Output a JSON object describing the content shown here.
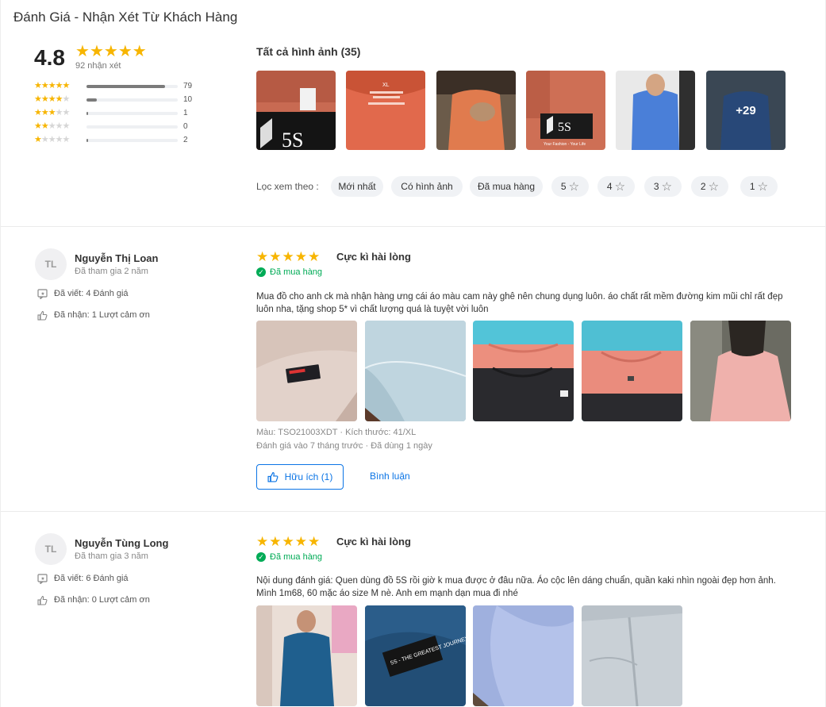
{
  "page_title": "Đánh Giá - Nhận Xét Từ Khách Hàng",
  "summary": {
    "score": "4.8",
    "reviews_count": "92 nhận xét",
    "distribution": [
      {
        "stars": 5,
        "count": "79",
        "fraction": 0.86
      },
      {
        "stars": 4,
        "count": "10",
        "fraction": 0.11
      },
      {
        "stars": 3,
        "count": "1",
        "fraction": 0.01
      },
      {
        "stars": 2,
        "count": "0",
        "fraction": 0.0
      },
      {
        "stars": 1,
        "count": "2",
        "fraction": 0.02
      }
    ]
  },
  "gallery": {
    "title": "Tất cả hình ảnh (35)",
    "more_label": "+29"
  },
  "filters": {
    "label": "Lọc xem theo :",
    "chips": [
      "Mới nhất",
      "Có hình ảnh",
      "Đã mua hàng",
      "5",
      "4",
      "3",
      "2",
      "1"
    ]
  },
  "reviews": [
    {
      "initials": "TL",
      "name": "Nguyễn Thị Loan",
      "joined": "Đã tham gia 2 năm",
      "written": "Đã viết: 4 Đánh giá",
      "received": "Đã nhận: 1 Lượt cảm ơn",
      "title": "Cực kì hài lòng",
      "bought": "Đã mua hàng",
      "text": "Mua đồ cho anh ck mà nhận hàng ưng cái áo màu cam này ghê nên chung dụng luôn. áo chất rất mềm đường kim mũi chỉ rất đẹp luôn nha, tặng shop 5* vì chất lượng quá là tuyệt vời luôn",
      "meta1": "Màu: TSO21003XDT  ·  Kích thước: 41/XL",
      "meta2": "Đánh giá vào 7 tháng trước  ·  Đã dùng 1 ngày",
      "helpful": "Hữu ích (1)",
      "reply": "Bình luận"
    },
    {
      "initials": "TL",
      "name": "Nguyễn Tùng Long",
      "joined": "Đã tham gia 3 năm",
      "written": "Đã viết: 6 Đánh giá",
      "received": "Đã nhận: 0 Lượt cảm ơn",
      "title": "Cực kì hài lòng",
      "bought": "Đã mua hàng",
      "text": "Nội dung đánh giá: Quen dùng đồ 5S rồi giờ k mua được ở đâu nữa. Áo cộc lên dáng chuẩn, quần kaki nhìn ngoài đẹp hơn ảnh. Mình 1m68, 60 mặc áo size M nè. Anh em mạnh dạn mua đi nhé"
    }
  ],
  "image_text": {
    "logo_5s": "5S",
    "tag_xl": "XL",
    "slogan": "Your Fashion - Your Life",
    "label_greatest": "5S - THE GREATEST JOURNEY"
  },
  "colors": {
    "star": "#f7b500",
    "accent": "#0b74e5",
    "bought": "#00ab56",
    "chip_bg": "#f0f2f5"
  }
}
